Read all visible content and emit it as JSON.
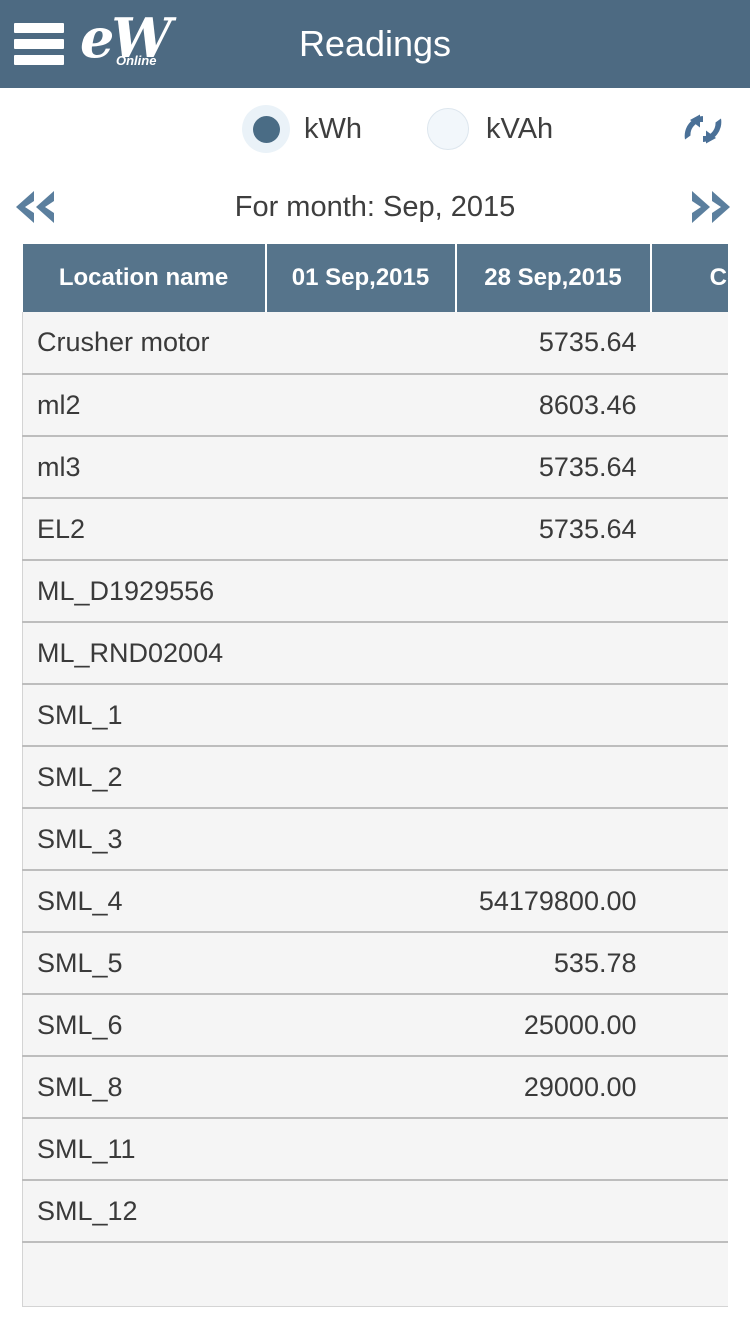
{
  "appbar": {
    "title": "Readings",
    "menu_icon": "hamburger-menu-icon",
    "logo_main": "eW",
    "logo_sub": "Online"
  },
  "unit_selector": {
    "options": [
      {
        "label": "kWh",
        "selected": true
      },
      {
        "label": "kVAh",
        "selected": false
      }
    ],
    "refresh_icon": "refresh-sync-icon"
  },
  "month_nav": {
    "prev_icon": "double-chevron-left-icon",
    "next_icon": "double-chevron-right-icon",
    "label": "For month: Sep, 2015"
  },
  "table": {
    "headers": {
      "location": "Location name",
      "date_start": "01 Sep,2015",
      "date_end": "28 Sep,2015",
      "consumption": "Consumption"
    },
    "rows": [
      {
        "location": "Crusher motor",
        "start": "",
        "end": "5735.64",
        "consumption": ""
      },
      {
        "location": "ml2",
        "start": "",
        "end": "8603.46",
        "consumption": ""
      },
      {
        "location": "ml3",
        "start": "",
        "end": "5735.64",
        "consumption": ""
      },
      {
        "location": "EL2",
        "start": "",
        "end": "5735.64",
        "consumption": ""
      },
      {
        "location": "ML_D1929556",
        "start": "",
        "end": "",
        "consumption": ""
      },
      {
        "location": "ML_RND02004",
        "start": "",
        "end": "",
        "consumption": ""
      },
      {
        "location": "SML_1",
        "start": "",
        "end": "",
        "consumption": ""
      },
      {
        "location": "SML_2",
        "start": "",
        "end": "",
        "consumption": ""
      },
      {
        "location": "SML_3",
        "start": "",
        "end": "",
        "consumption": ""
      },
      {
        "location": "SML_4",
        "start": "",
        "end": "54179800.00",
        "consumption": ""
      },
      {
        "location": "SML_5",
        "start": "",
        "end": "535.78",
        "consumption": ""
      },
      {
        "location": "SML_6",
        "start": "",
        "end": "25000.00",
        "consumption": ""
      },
      {
        "location": "SML_8",
        "start": "",
        "end": "29000.00",
        "consumption": ""
      },
      {
        "location": "SML_11",
        "start": "",
        "end": "",
        "consumption": ""
      },
      {
        "location": "SML_12",
        "start": "",
        "end": "",
        "consumption": ""
      },
      {
        "location": "",
        "start": "",
        "end": "",
        "consumption": ""
      }
    ]
  },
  "colors": {
    "appbar_blue": "#4d6a82",
    "table_header_blue": "#56748b",
    "accent_blue": "#4a6c85",
    "row_background": "#f5f5f5",
    "row_divider": "#bdbdbd"
  }
}
